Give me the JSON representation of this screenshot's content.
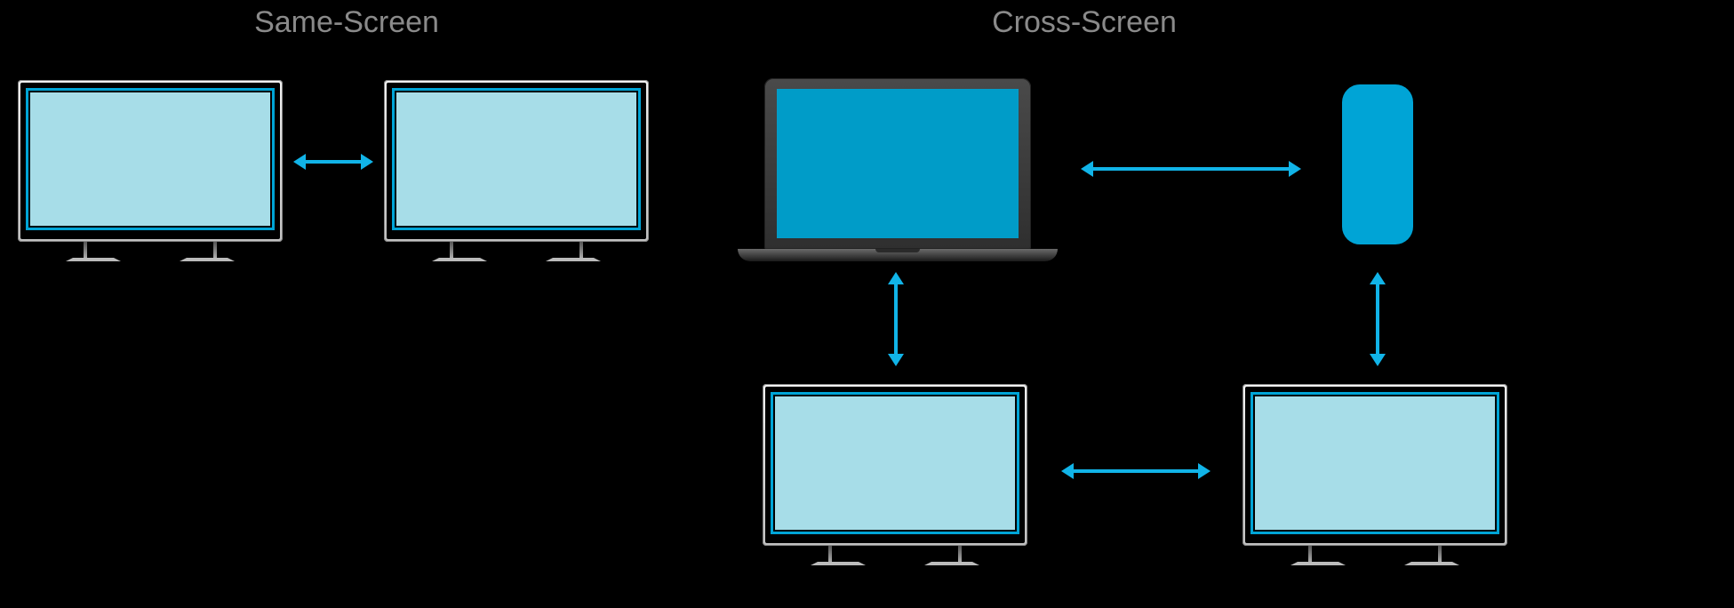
{
  "headings": {
    "same_screen": "Same-Screen",
    "cross_screen": "Cross-Screen"
  },
  "devices": {
    "same": {
      "left": {
        "type": "tv"
      },
      "right": {
        "type": "tv"
      }
    },
    "cross": {
      "laptop": {
        "type": "laptop"
      },
      "phone": {
        "type": "phone"
      },
      "tv_left": {
        "type": "tv"
      },
      "tv_right": {
        "type": "tv"
      }
    }
  },
  "arrows": {
    "same_h": "bidirectional",
    "cross_top_h": "bidirectional",
    "cross_bottom_h": "bidirectional",
    "cross_left_v": "bidirectional",
    "cross_right_v": "bidirectional"
  },
  "colors": {
    "accent": "#11b4e8",
    "screen_fill_light": "#a7dde8",
    "screen_fill_solid": "#009cc8",
    "phone_fill": "#00a4d6",
    "heading": "#8a8a8a",
    "background": "#000000"
  }
}
